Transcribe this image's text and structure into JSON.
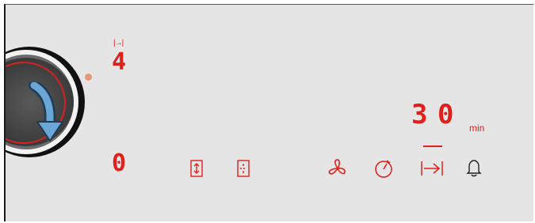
{
  "display": {
    "top_symbol": "|→|",
    "top_level": "4",
    "bottom_level": "0",
    "timer_digits": [
      "3",
      "0"
    ],
    "timer_unit": "min"
  },
  "icons": {
    "duration_icon": "duration-icon",
    "zone_split_icon": "zone-split-icon",
    "fan_icon": "fan-icon",
    "stopwatch_icon": "stopwatch-icon",
    "timer_icon": "timer-icon",
    "bell_icon": "bell-icon"
  },
  "colors": {
    "display_red": "#e0201a",
    "panel_bg": "#e5e5e5",
    "knob_dark": "#2a2a2a",
    "arrow_blue": "#4a90c8"
  }
}
